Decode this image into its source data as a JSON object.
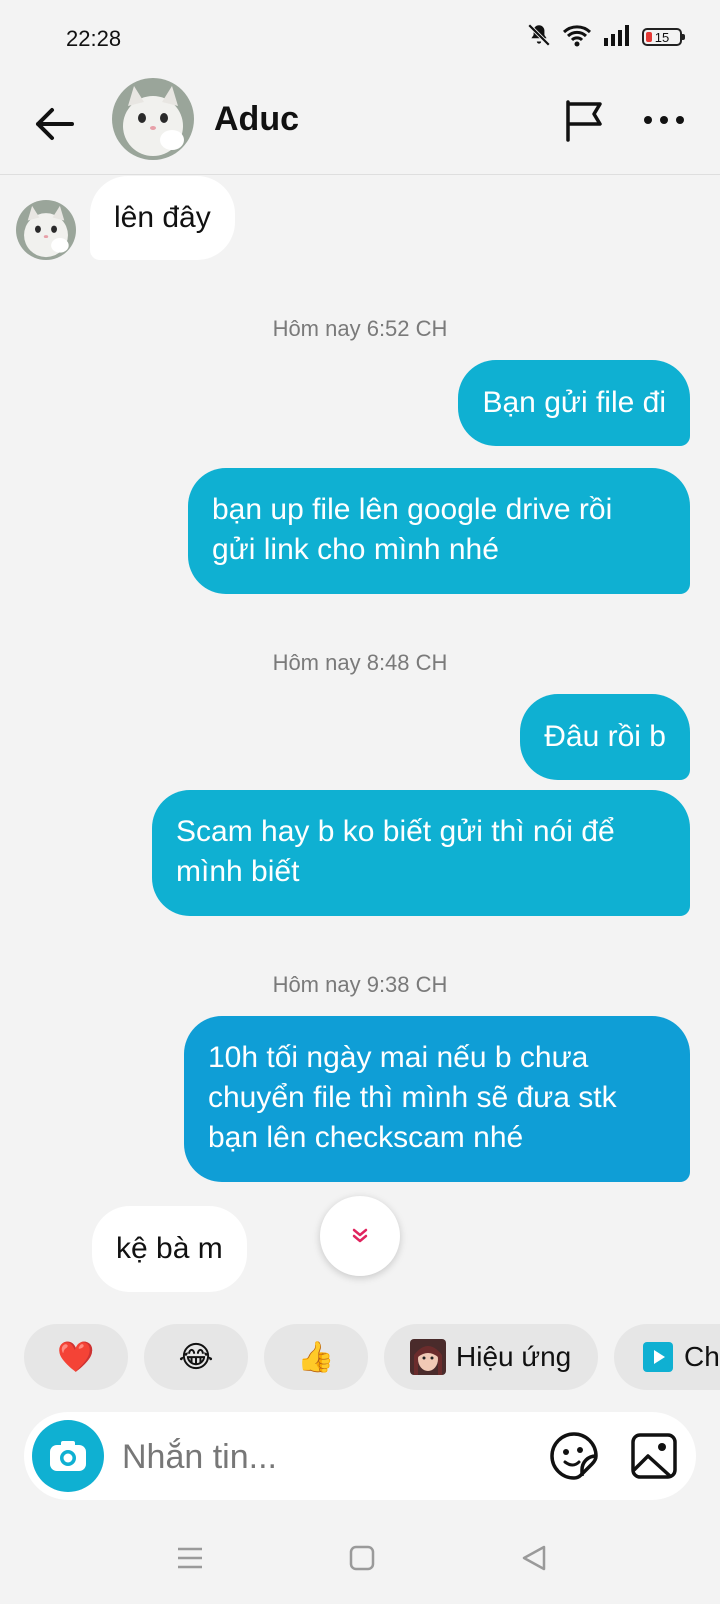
{
  "status_bar": {
    "time": "22:28",
    "battery": "15",
    "icons": [
      "bell-off-icon",
      "wifi-icon",
      "signal-icon",
      "battery-icon"
    ]
  },
  "header": {
    "contact_name": "Aduc",
    "icons": [
      "back-arrow-icon",
      "avatar",
      "flag-icon",
      "more-icon"
    ]
  },
  "messages": [
    {
      "side": "in",
      "text": "lên đây"
    },
    {
      "timestamp": "Hôm nay 6:52 CH"
    },
    {
      "side": "out",
      "text": "Bạn gửi file đi"
    },
    {
      "side": "out",
      "lines": [
        "bạn up file lên google drive rồi",
        "gửi link cho mình nhé"
      ]
    },
    {
      "timestamp": "Hôm nay 8:48 CH"
    },
    {
      "side": "out",
      "text": "Đâu rồi b"
    },
    {
      "side": "out",
      "lines": [
        "Scam hay b ko biết gửi thì nói để",
        "mình biết"
      ]
    },
    {
      "timestamp": "Hôm nay 9:38 CH"
    },
    {
      "side": "out",
      "lines": [
        "10h tối ngày mai nếu b chưa",
        "chuyển file thì mình sẽ đưa stk",
        "bạn lên checkscam nhé"
      ]
    },
    {
      "side": "in",
      "text": "kệ bà m"
    }
  ],
  "reactions": [
    {
      "emoji": "❤️",
      "name": "heart"
    },
    {
      "emoji": "😂",
      "name": "laugh"
    },
    {
      "emoji": "👍",
      "name": "thumbs-up"
    },
    {
      "label": "Hiệu ứng",
      "icon": "effects-avatar-icon"
    },
    {
      "label": "Ch",
      "icon": "play-square-icon"
    }
  ],
  "composer": {
    "placeholder": "Nhắn tin...",
    "icons": [
      "camera-icon",
      "sticker-icon",
      "gallery-icon"
    ]
  },
  "colors": {
    "outgoing_bubble": "#0fb0d2",
    "incoming_bubble": "#ffffff",
    "background": "#f3f3f3"
  }
}
